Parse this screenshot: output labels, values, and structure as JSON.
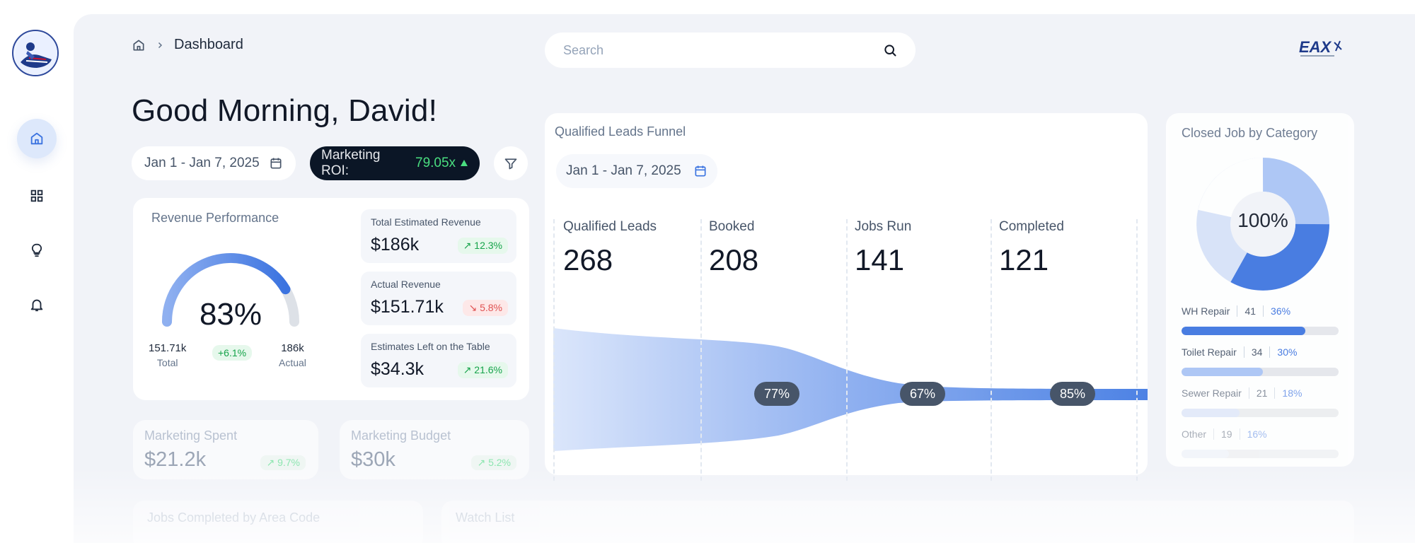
{
  "breadcrumb": {
    "home_icon": "home-icon",
    "separator_icon": "chevron-right-icon",
    "current": "Dashboard"
  },
  "search": {
    "placeholder": "Search",
    "icon": "search-icon"
  },
  "greeting": "Good Morning, David!",
  "date_range": {
    "label": "Jan 1 - Jan 7, 2025",
    "icon": "calendar-icon"
  },
  "roi": {
    "label": "Marketing ROI:",
    "value": "79.05x",
    "trend_icon": "triangle-up-icon"
  },
  "filter": {
    "icon": "filter-icon"
  },
  "nav": {
    "items": [
      {
        "name": "home",
        "icon": "home-icon",
        "active": true
      },
      {
        "name": "grid",
        "icon": "grid-icon",
        "active": false
      },
      {
        "name": "insights",
        "icon": "lightbulb-icon",
        "active": false
      },
      {
        "name": "notifications",
        "icon": "bell-icon",
        "active": false
      }
    ]
  },
  "revenue": {
    "title": "Revenue Performance",
    "gauge_value": "83%",
    "gauge_fraction": 0.83,
    "total_value": "151.71k",
    "total_label": "Total",
    "actual_value": "186k",
    "actual_label": "Actual",
    "change": "+6.1%",
    "metrics": [
      {
        "label": "Total Estimated Revenue",
        "value": "$186k",
        "change": "12.3%",
        "direction": "up"
      },
      {
        "label": "Actual Revenue",
        "value": "$151.71k",
        "change": "5.8%",
        "direction": "down"
      },
      {
        "label": "Estimates Left on the Table",
        "value": "$34.3k",
        "change": "21.6%",
        "direction": "up"
      }
    ]
  },
  "marketing": {
    "spent": {
      "label": "Marketing Spent",
      "value": "$21.2k",
      "change": "9.7%"
    },
    "budget": {
      "label": "Marketing Budget",
      "value": "$30k",
      "change": "5.2%"
    }
  },
  "funnel": {
    "title": "Qualified Leads Funnel",
    "date": "Jan 1 - Jan 7, 2025",
    "stages": [
      {
        "label": "Qualified Leads",
        "value": "268"
      },
      {
        "label": "Booked",
        "value": "208"
      },
      {
        "label": "Jobs Run",
        "value": "141"
      },
      {
        "label": "Completed",
        "value": "121"
      }
    ],
    "conversions": [
      "77%",
      "67%",
      "85%"
    ]
  },
  "category": {
    "title": "Closed Job by Category",
    "total": "100%",
    "items": [
      {
        "label": "WH Repair",
        "count": "41",
        "percent": "36%",
        "fraction": 0.79,
        "color": "#3b73e0"
      },
      {
        "label": "Toilet Repair",
        "count": "34",
        "percent": "30%",
        "fraction": 0.52,
        "color": "#a9c4f5"
      },
      {
        "label": "Sewer Repair",
        "count": "21",
        "percent": "18%",
        "fraction": 0.37,
        "color": "#d6e2f8"
      },
      {
        "label": "Other",
        "count": "19",
        "percent": "16%",
        "fraction": 0.3,
        "color": "#e8eef9"
      }
    ]
  },
  "bottom": {
    "left_title": "Jobs Completed by Area Code",
    "right_title": "Watch List"
  },
  "colors": {
    "accent": "#3b73e0",
    "dark": "#0b1626",
    "positive": "#16a34a",
    "negative": "#e05252"
  }
}
